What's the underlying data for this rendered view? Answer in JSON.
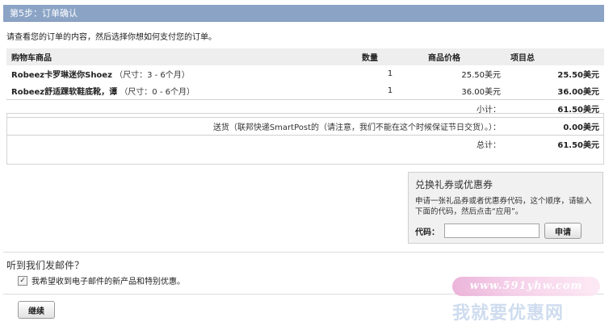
{
  "step": {
    "title": "第5步：订单确认"
  },
  "intro": "请查看您的订单的内容，然后选择你想如何支付您的订单。",
  "cart": {
    "headers": {
      "item": "购物车商品",
      "qty": "数量",
      "price": "商品价格",
      "total": "项目总"
    },
    "items": [
      {
        "name": "Robeez卡罗琳迷你Shoez",
        "note": "（尺寸：3 - 6个月）",
        "qty": "1",
        "price": "25.50美元",
        "total": "25.50美元"
      },
      {
        "name": "Robeez舒适踝软鞋底靴，谭",
        "note": "（尺寸：0 - 6个月）",
        "qty": "1",
        "price": "36.00美元",
        "total": "36.00美元"
      }
    ],
    "summary": [
      {
        "label": "小计：",
        "value": "61.50美元"
      },
      {
        "label": "送货（联邦快递SmartPost的（请注意，我们不能在这个时候保证节日交货）。）：",
        "value": "0.00美元"
      },
      {
        "label": "总计：",
        "value": "61.50美元"
      }
    ]
  },
  "coupon": {
    "title": "兑换礼券或优惠券",
    "description": "申请一张礼品券或者优惠券代码，这个顺序，请输入下面的代码，然后点击“应用”。",
    "code_label": "代码：",
    "code_value": "",
    "apply_label": "申请"
  },
  "email": {
    "heading": "听到我们发邮件？",
    "checkbox_checked": true,
    "checkbox_label": "我希望收到电子邮件的新产品和特别优惠。"
  },
  "continue_label": "继续",
  "watermark": {
    "url": "www.591yhw.com",
    "text": "我就要优惠网"
  }
}
